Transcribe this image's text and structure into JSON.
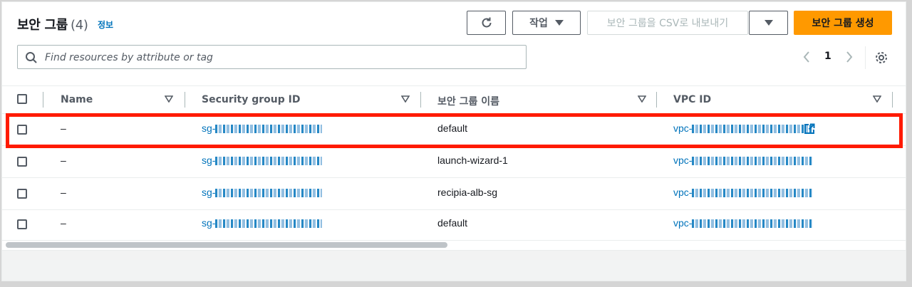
{
  "header": {
    "title": "보안 그룹",
    "count": "(4)",
    "info": "정보",
    "actions_label": "작업",
    "export_label": "보안 그룹을 CSV로 내보내기",
    "create_label": "보안 그룹 생성"
  },
  "search": {
    "placeholder": "Find resources by attribute or tag"
  },
  "pagination": {
    "current_page": "1"
  },
  "table": {
    "columns": [
      "Name",
      "Security group ID",
      "보안 그룹 이름",
      "VPC ID"
    ],
    "rows": [
      {
        "name": "–",
        "sg_prefix": "sg-",
        "sg_name": "default",
        "vpc_prefix": "vpc-"
      },
      {
        "name": "–",
        "sg_prefix": "sg-",
        "sg_name": "launch-wizard-1",
        "vpc_prefix": "vpc-"
      },
      {
        "name": "–",
        "sg_prefix": "sg-",
        "sg_name": "recipia-alb-sg",
        "vpc_prefix": "vpc-"
      },
      {
        "name": "–",
        "sg_prefix": "sg-",
        "sg_name": "default",
        "vpc_prefix": "vpc-"
      }
    ]
  },
  "colors": {
    "link": "#0073bb",
    "primary_button": "#ff9900",
    "highlight": "#ff1a00"
  },
  "icons": [
    "refresh-icon",
    "caret-down-icon",
    "search-icon",
    "chevron-left-icon",
    "chevron-right-icon",
    "gear-icon",
    "sort-icon",
    "external-link-icon"
  ]
}
